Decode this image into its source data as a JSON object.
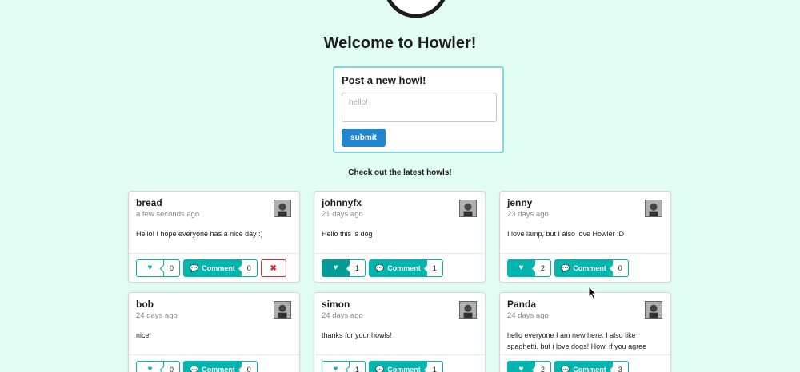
{
  "header": {
    "title": "Welcome to Howler!"
  },
  "post_form": {
    "title": "Post a new howl!",
    "placeholder": "hello!",
    "submit_label": "submit"
  },
  "feed": {
    "label": "Check out the latest howls!",
    "comment_label": "Comment",
    "delete_label": "✖",
    "howls": [
      {
        "username": "bread",
        "time": "a few seconds ago",
        "message": "Hello! I hope everyone has a nice day :)",
        "likes": "0",
        "comments": "0"
      },
      {
        "username": "johnnyfx",
        "time": "21 days ago",
        "message": "Hello this is dog",
        "likes": "1",
        "comments": "1"
      },
      {
        "username": "jenny",
        "time": "23 days ago",
        "message": "I love lamp, but I also love Howler :D",
        "likes": "2",
        "comments": "0"
      },
      {
        "username": "bob",
        "time": "24 days ago",
        "message": "nice!",
        "likes": "0",
        "comments": "0"
      },
      {
        "username": "simon",
        "time": "24 days ago",
        "message": "thanks for your howls!",
        "likes": "1",
        "comments": "1"
      },
      {
        "username": "Panda",
        "time": "24 days ago",
        "message": "hello everyone I am new here. I also like spaghetti. but i love dogs! Howl if you agree",
        "likes": "2",
        "comments": "3"
      }
    ]
  },
  "colors": {
    "background": "#e1fdf3",
    "teal": "#00b5ad",
    "teal_dark": "#009c95",
    "blue": "#2185d0",
    "red": "#db2828"
  }
}
